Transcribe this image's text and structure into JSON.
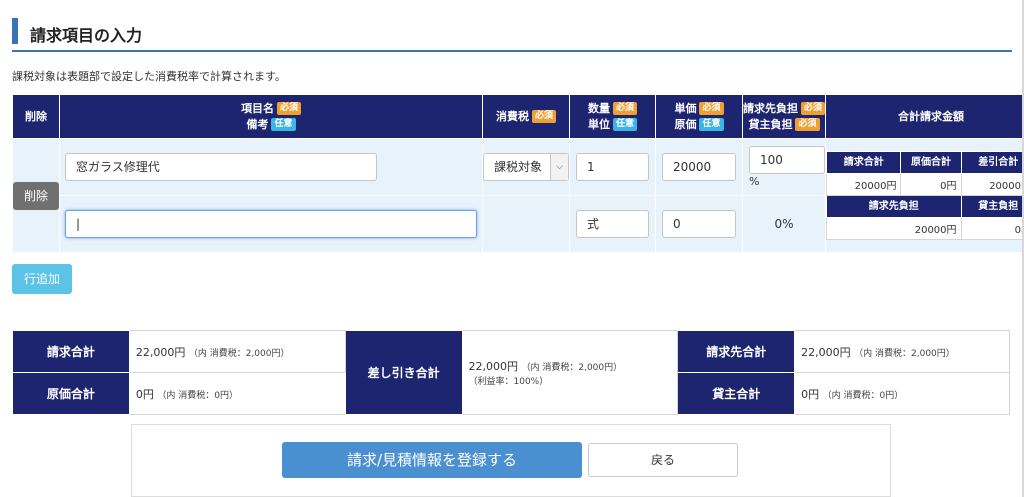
{
  "header": {
    "title": "請求項目の入力"
  },
  "note": "課税対象は表題部で設定した消費税率で計算されます。",
  "badges": {
    "required": "必須",
    "optional": "任意"
  },
  "columns": {
    "delete": "削除",
    "item_name": "項目名",
    "remarks": "備考",
    "tax": "消費税",
    "quantity": "数量",
    "unit": "単位",
    "unit_price": "単価",
    "cost": "原価",
    "billing_burden": "請求先負担",
    "lessor_burden": "貸主負担",
    "total_amount": "合計請求金額"
  },
  "row": {
    "delete_label": "削除",
    "item_name_value": "窓ガラス修理代",
    "tax_value": "課税対象",
    "quantity_value": "1",
    "unit_price_value": "20000",
    "burden_value": "100",
    "burden_unit": "%",
    "remarks_value": "",
    "unit_value": "式",
    "cost_value": "0",
    "lessor_percent": "0%"
  },
  "mini_summary": {
    "headers1": [
      "請求合計",
      "原価合計",
      "差引合計"
    ],
    "values1": [
      "20000円",
      "0円",
      "20000円"
    ],
    "headers2": [
      "請求先負担",
      "貸主負担"
    ],
    "values2": [
      "20000円",
      "0円"
    ]
  },
  "add_row_label": "行追加",
  "totals": {
    "billing_total_label": "請求合計",
    "billing_total_value": "22,000円",
    "billing_total_sub": "（内 消費税：2,000円）",
    "cost_total_label": "原価合計",
    "cost_total_value": "0円",
    "cost_total_sub": "（内 消費税：0円）",
    "diff_total_label": "差し引き合計",
    "diff_total_value": "22,000円",
    "diff_total_sub": "（内 消費税：2,000円）",
    "diff_total_margin": "（利益率：100%）",
    "billing_party_label": "請求先合計",
    "billing_party_value": "22,000円",
    "billing_party_sub": "（内 消費税：2,000円）",
    "lessor_label": "貸主合計",
    "lessor_value": "0円",
    "lessor_sub": "（内 消費税：0円）"
  },
  "actions": {
    "submit_label": "請求/見積情報を登録する",
    "back_label": "戻る"
  }
}
